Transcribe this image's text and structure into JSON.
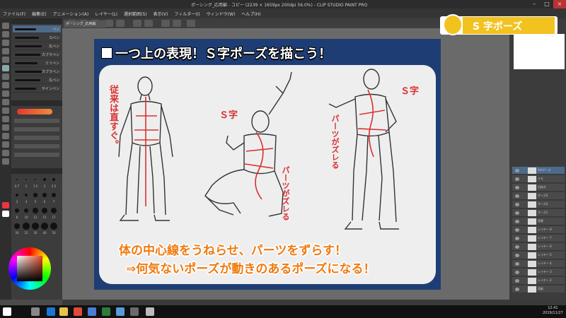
{
  "window": {
    "title": "ポーシング_応用編 - コピー (2239 × 1659px 200dpi 56.0%) - CLIP STUDIO PAINT PRO"
  },
  "menu": [
    "ファイル(F)",
    "編集(E)",
    "アニメーション(A)",
    "レイヤー(L)",
    "選択範囲(S)",
    "表示(V)",
    "フィルター(I)",
    "ウィンドウ(W)",
    "ヘルプ(H)"
  ],
  "document_tab": "ポーシング_応用編",
  "badge": {
    "label": "S 字ポーズ",
    "color": "#f2c21f"
  },
  "slide": {
    "heading": "一つ上の表現！Ｓ字ポーズを描こう！",
    "notes": {
      "left_vertical": "従来は直すぐ。",
      "middle_s": "Ｓ字",
      "middle_vertical": "パーツがズレる",
      "right_s": "Ｓ字",
      "right_vertical": "パーツがズレる"
    },
    "caption_line1": "体の中心線をうねらせ、パーツをずらす！",
    "caption_line2": "⇒何気ないポーズが動きのあるポーズになる！",
    "colors": {
      "frame": "#1e3d74",
      "caption": "#f07a0f",
      "notes": "#d93030"
    }
  },
  "left_panel": {
    "brushes": [
      "ペン",
      "Gペン",
      "丸ペン",
      "カブラペン",
      "ミリペン",
      "カブラペン",
      "丸ペン",
      "サインペン"
    ],
    "sizes": [
      "0.7",
      "1",
      "1.5",
      "2",
      "2.5",
      "3",
      "4",
      "5",
      "6",
      "7",
      "8",
      "10",
      "12",
      "15",
      "17",
      "20",
      "25",
      "30",
      "40",
      "50"
    ]
  },
  "right_panel": {
    "layers": [
      "S字ポーズ",
      "メモ",
      "白抜き",
      "ポーズ3",
      "ポーズ2",
      "ポーズ1",
      "背景",
      "レイヤー 8",
      "レイヤー 7",
      "レイヤー 6",
      "レイヤー 5",
      "レイヤー 4",
      "レイヤー 3",
      "レイヤー 2",
      "用紙"
    ]
  },
  "taskbar": {
    "time": "12:41",
    "date": "2019/11/27"
  }
}
